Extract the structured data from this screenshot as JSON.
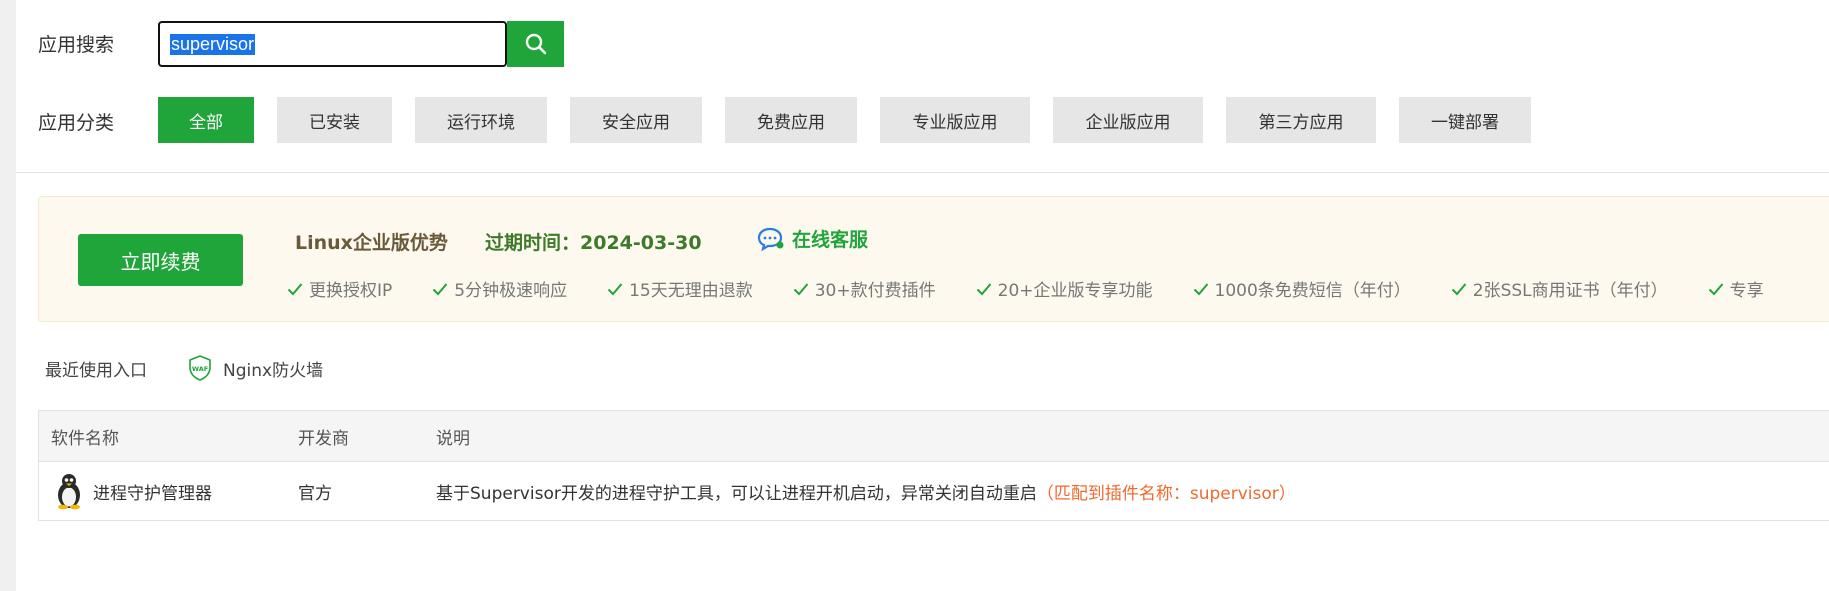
{
  "search": {
    "label": "应用搜索",
    "value": "supervisor"
  },
  "categories": {
    "label": "应用分类",
    "items": [
      "全部",
      "已安装",
      "运行环境",
      "安全应用",
      "免费应用",
      "专业版应用",
      "企业版应用",
      "第三方应用",
      "一键部署"
    ],
    "active_index": 0
  },
  "promo": {
    "renew_label": "立即续费",
    "title": "Linux企业版优势",
    "expire": "过期时间：2024-03-30",
    "service": "在线客服",
    "features": [
      "更换授权IP",
      "5分钟极速响应",
      "15天无理由退款",
      "30+款付费插件",
      "20+企业版专享功能",
      "1000条免费短信（年付）",
      "2张SSL商用证书（年付）",
      "专享"
    ]
  },
  "recent": {
    "label": "最近使用入口",
    "items": [
      {
        "name": "Nginx防火墙",
        "icon": "waf-shield-icon"
      }
    ]
  },
  "table": {
    "headers": [
      "软件名称",
      "开发商",
      "说明"
    ],
    "rows": [
      {
        "name": "进程守护管理器",
        "icon": "linux-penguin-icon",
        "developer": "官方",
        "description": "基于Supervisor开发的进程守护工具，可以让进程开机启动，异常关闭自动重启",
        "match_note": "（匹配到插件名称：supervisor）"
      }
    ]
  },
  "colors": {
    "accent": "#20a53a",
    "match": "#f06a2e",
    "promo_bg": "#fdf9ef"
  }
}
